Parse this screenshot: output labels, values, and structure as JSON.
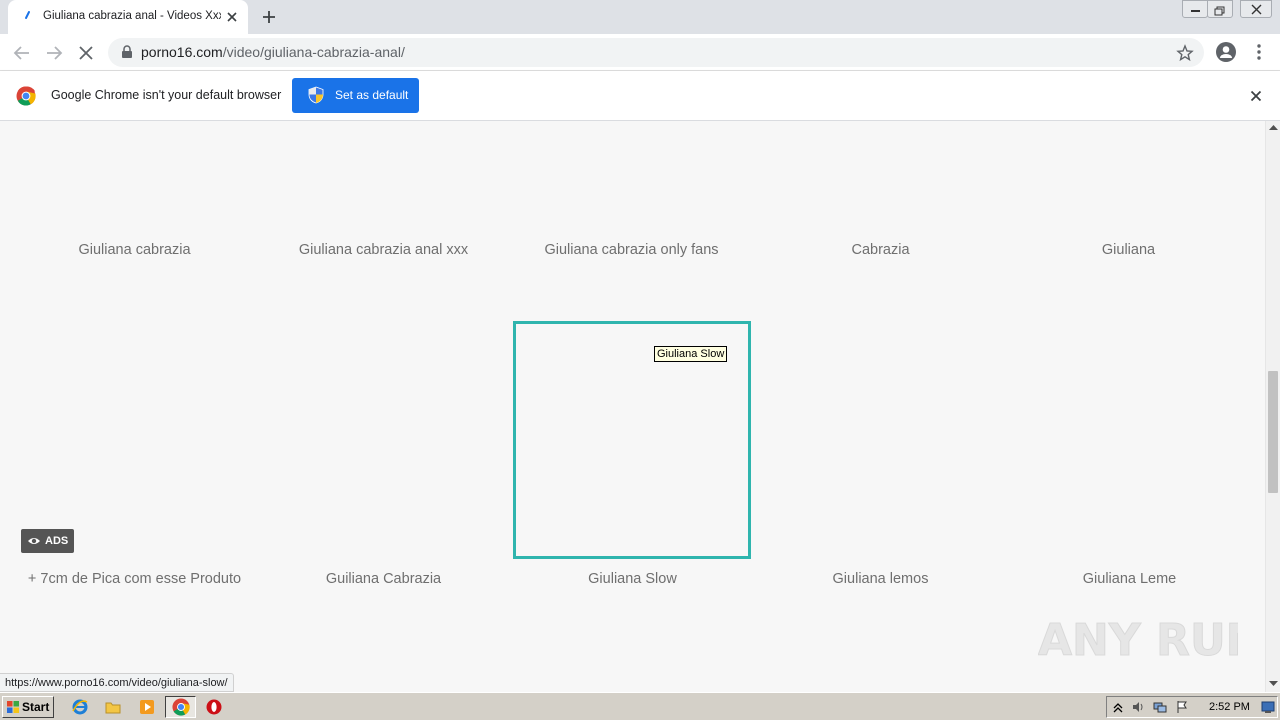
{
  "browser": {
    "tab": {
      "title": "Giuliana cabrazia anal - Videos Xxx | "
    },
    "address": {
      "host": "porno16.com",
      "path": "/video/giuliana-cabrazia-anal/"
    },
    "infobar": {
      "message": "Google Chrome isn't your default browser",
      "button_label": "Set as default"
    },
    "status_url": "https://www.porno16.com/video/giuliana-slow/"
  },
  "page": {
    "row1_captions": [
      "Giuliana cabrazia",
      "Giuliana cabrazia anal xxx",
      "Giuliana cabrazia only fans",
      "Cabrazia",
      "Giuliana"
    ],
    "row2_captions": [
      "+ 7cm de Pica com esse Produto",
      "Guiliana Cabrazia",
      "Giuliana Slow",
      "Giuliana lemos",
      "Giuliana Leme"
    ],
    "tooltip": "Giuliana Slow",
    "ads_label": "ADS",
    "watermark_text": "ANY RUN",
    "highlight_color": "#2fb5ae"
  },
  "taskbar": {
    "start_label": "Start",
    "clock": "2:52 PM"
  },
  "icons": {
    "tab": [
      "page-favicon-icon",
      "close-icon",
      "plus-icon"
    ],
    "toolbar": [
      "back-arrow-icon",
      "forward-arrow-icon",
      "stop-loading-icon",
      "lock-icon",
      "star-icon",
      "account-icon",
      "more-vert-icon"
    ],
    "infobar": [
      "chrome-logo-icon",
      "shield-icon",
      "close-icon"
    ],
    "taskbar": [
      "windows-flag-icon",
      "ie-icon",
      "explorer-folder-icon",
      "media-player-icon",
      "chrome-icon",
      "opera-icon"
    ],
    "tray": [
      "chevron-up-icon",
      "speaker-icon",
      "network-icon",
      "action-center-flag-icon",
      "show-desktop-icon"
    ]
  }
}
